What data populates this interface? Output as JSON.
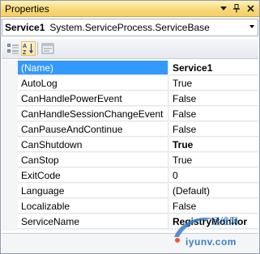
{
  "window": {
    "title": "Properties"
  },
  "object_selector": {
    "name": "Service1",
    "type": "System.ServiceProcess.ServiceBase"
  },
  "toolbar": {
    "buttons": [
      "categorized-icon",
      "alphabetical-icon",
      "property-pages-icon"
    ],
    "alpha_label": "A Z"
  },
  "properties": [
    {
      "name": "(Name)",
      "value": "Service1",
      "bold": true,
      "selected": true
    },
    {
      "name": "AutoLog",
      "value": "True",
      "bold": false
    },
    {
      "name": "CanHandlePowerEvent",
      "value": "False",
      "bold": false
    },
    {
      "name": "CanHandleSessionChangeEvent",
      "value": "False",
      "bold": false
    },
    {
      "name": "CanPauseAndContinue",
      "value": "False",
      "bold": false
    },
    {
      "name": "CanShutdown",
      "value": "True",
      "bold": true
    },
    {
      "name": "CanStop",
      "value": "True",
      "bold": false
    },
    {
      "name": "ExitCode",
      "value": "0",
      "bold": false
    },
    {
      "name": "Language",
      "value": "(Default)",
      "bold": false
    },
    {
      "name": "Localizable",
      "value": "False",
      "bold": false
    },
    {
      "name": "ServiceName",
      "value": "RegistryMonitor",
      "bold": true
    }
  ],
  "watermark": {
    "text": "iyunv.com",
    "cjk": "运维网"
  },
  "colors": {
    "title_gradient_top": "#fef3bd",
    "title_gradient_bottom": "#f4cf66",
    "selection": "#3399ff",
    "watermark": "#3a7fc6"
  }
}
